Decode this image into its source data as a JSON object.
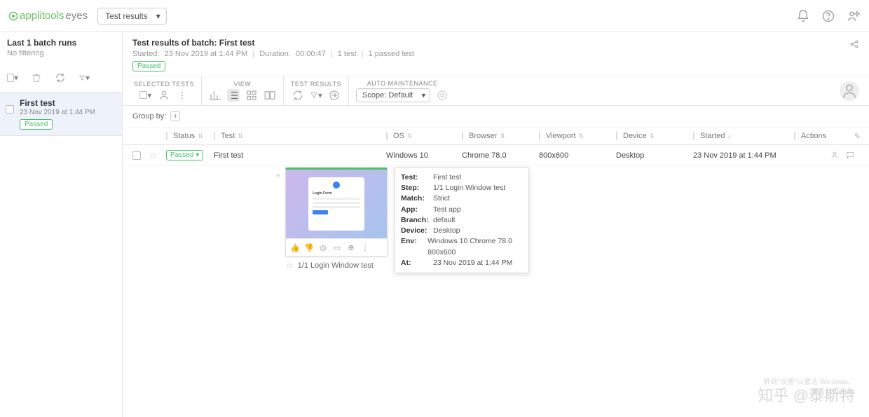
{
  "brand": {
    "name": "applitools",
    "sub": "eyes"
  },
  "topSelect": "Test results",
  "sidebar": {
    "title": "Last 1 batch runs",
    "subtitle": "No filtering",
    "batch": {
      "name": "First test",
      "date": "23 Nov 2019 at 1:44 PM",
      "status": "Passed"
    }
  },
  "mainHead": {
    "title": "Test results of batch: First test",
    "started_label": "Started:",
    "started": "23 Nov 2019 at 1:44 PM",
    "duration_label": "Duration:",
    "duration": "00:00:47",
    "tests": "1 test",
    "passed": "1 passed test",
    "status": "Passed"
  },
  "toolGroups": {
    "selected": "SELECTED TESTS",
    "view": "VIEW",
    "results": "TEST RESULTS",
    "auto": "AUTO MAINTENANCE",
    "scope": "Scope: Default"
  },
  "groupByLabel": "Group by:",
  "columns": {
    "status": "Status",
    "test": "Test",
    "os": "OS",
    "browser": "Browser",
    "viewport": "Viewport",
    "device": "Device",
    "started": "Started",
    "actions": "Actions"
  },
  "row": {
    "status": "Passed",
    "test": "First test",
    "os": "Windows 10",
    "browser": "Chrome 78.0",
    "viewport": "800x600",
    "device": "Desktop",
    "started": "23 Nov 2019 at 1:44 PM"
  },
  "tooltip": {
    "Test": "First test",
    "Step": "1/1 Login Window test",
    "Match": "Strict",
    "App": "Test app",
    "Branch": "default",
    "Device": "Desktop",
    "Env": "Windows 10 Chrome 78.0 800x600",
    "At": "23 Nov 2019 at 1:44 PM"
  },
  "thumbCard": {
    "title": "Login Form"
  },
  "stepCaption": "1/1 Login Window test",
  "watermark": "知乎 @泰斯特",
  "winActivate1": "激活 Windows",
  "winActivate2": "转到\"设置\"以激活 Windows。"
}
